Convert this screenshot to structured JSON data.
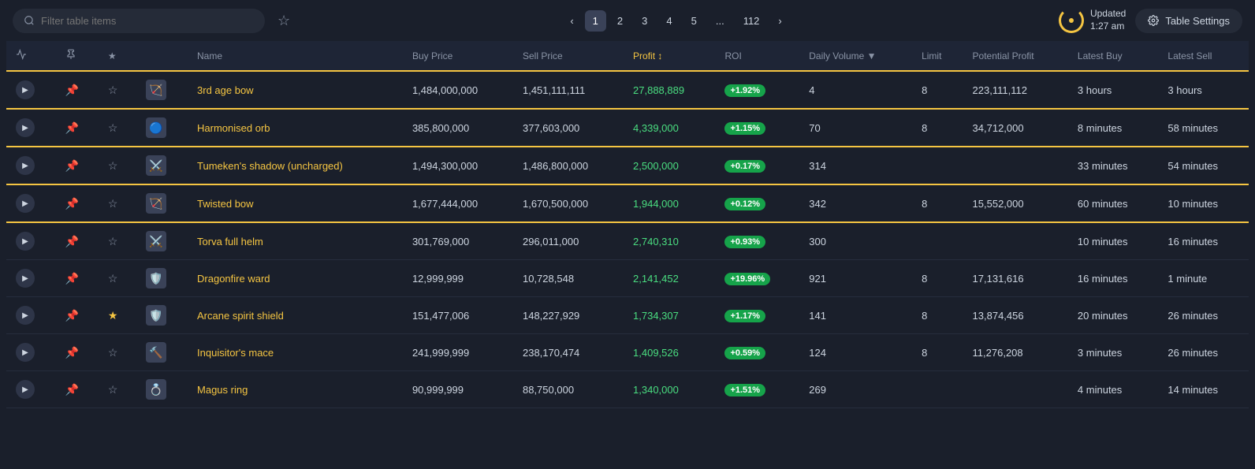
{
  "topbar": {
    "search_placeholder": "Filter table items",
    "pagination": {
      "prev": "‹",
      "next": "›",
      "pages": [
        "1",
        "2",
        "3",
        "4",
        "5",
        "...",
        "112"
      ],
      "active": "1"
    },
    "updated": {
      "label": "Updated",
      "time": "1:27 am"
    },
    "settings_label": "Table Settings"
  },
  "table": {
    "columns": [
      {
        "key": "expand",
        "label": ""
      },
      {
        "key": "pin",
        "label": ""
      },
      {
        "key": "star",
        "label": ""
      },
      {
        "key": "icon",
        "label": ""
      },
      {
        "key": "name",
        "label": "Name"
      },
      {
        "key": "buy_price",
        "label": "Buy Price"
      },
      {
        "key": "sell_price",
        "label": "Sell Price"
      },
      {
        "key": "profit",
        "label": "Profit"
      },
      {
        "key": "roi",
        "label": "ROI"
      },
      {
        "key": "daily_volume",
        "label": "Daily Volume"
      },
      {
        "key": "limit",
        "label": "Limit"
      },
      {
        "key": "potential_profit",
        "label": "Potential Profit"
      },
      {
        "key": "latest_buy",
        "label": "Latest Buy"
      },
      {
        "key": "latest_sell",
        "label": "Latest Sell"
      }
    ],
    "rows": [
      {
        "id": 1,
        "pinned": true,
        "starred": false,
        "icon": "🏹",
        "name": "3rd age bow",
        "buy_price": "1,484,000,000",
        "sell_price": "1,451,111,111",
        "profit": "27,888,889",
        "roi": "+1.92%",
        "daily_volume": "4",
        "limit": "8",
        "potential_profit": "223,111,112",
        "latest_buy": "3 hours",
        "latest_sell": "3 hours"
      },
      {
        "id": 2,
        "pinned": true,
        "starred": false,
        "icon": "🔵",
        "name": "Harmonised orb",
        "buy_price": "385,800,000",
        "sell_price": "377,603,000",
        "profit": "4,339,000",
        "roi": "+1.15%",
        "daily_volume": "70",
        "limit": "8",
        "potential_profit": "34,712,000",
        "latest_buy": "8 minutes",
        "latest_sell": "58 minutes"
      },
      {
        "id": 3,
        "pinned": true,
        "starred": false,
        "icon": "⚔️",
        "name": "Tumeken's shadow (uncharged)",
        "buy_price": "1,494,300,000",
        "sell_price": "1,486,800,000",
        "profit": "2,500,000",
        "roi": "+0.17%",
        "daily_volume": "314",
        "limit": "",
        "potential_profit": "",
        "latest_buy": "33 minutes",
        "latest_sell": "54 minutes"
      },
      {
        "id": 4,
        "pinned": true,
        "starred": false,
        "icon": "🏹",
        "name": "Twisted bow",
        "buy_price": "1,677,444,000",
        "sell_price": "1,670,500,000",
        "profit": "1,944,000",
        "roi": "+0.12%",
        "daily_volume": "342",
        "limit": "8",
        "potential_profit": "15,552,000",
        "latest_buy": "60 minutes",
        "latest_sell": "10 minutes"
      },
      {
        "id": 5,
        "pinned": false,
        "starred": false,
        "icon": "⚔️",
        "name": "Torva full helm",
        "buy_price": "301,769,000",
        "sell_price": "296,011,000",
        "profit": "2,740,310",
        "roi": "+0.93%",
        "daily_volume": "300",
        "limit": "",
        "potential_profit": "",
        "latest_buy": "10 minutes",
        "latest_sell": "16 minutes"
      },
      {
        "id": 6,
        "pinned": false,
        "starred": false,
        "icon": "🛡️",
        "name": "Dragonfire ward",
        "buy_price": "12,999,999",
        "sell_price": "10,728,548",
        "profit": "2,141,452",
        "roi": "+19.96%",
        "daily_volume": "921",
        "limit": "8",
        "potential_profit": "17,131,616",
        "latest_buy": "16 minutes",
        "latest_sell": "1 minute"
      },
      {
        "id": 7,
        "pinned": false,
        "starred": true,
        "icon": "🛡️",
        "name": "Arcane spirit shield",
        "buy_price": "151,477,006",
        "sell_price": "148,227,929",
        "profit": "1,734,307",
        "roi": "+1.17%",
        "daily_volume": "141",
        "limit": "8",
        "potential_profit": "13,874,456",
        "latest_buy": "20 minutes",
        "latest_sell": "26 minutes"
      },
      {
        "id": 8,
        "pinned": false,
        "starred": false,
        "icon": "🔨",
        "name": "Inquisitor's mace",
        "buy_price": "241,999,999",
        "sell_price": "238,170,474",
        "profit": "1,409,526",
        "roi": "+0.59%",
        "daily_volume": "124",
        "limit": "8",
        "potential_profit": "11,276,208",
        "latest_buy": "3 minutes",
        "latest_sell": "26 minutes"
      },
      {
        "id": 9,
        "pinned": false,
        "starred": false,
        "icon": "💍",
        "name": "Magus ring",
        "buy_price": "90,999,999",
        "sell_price": "88,750,000",
        "profit": "1,340,000",
        "roi": "+1.51%",
        "daily_volume": "269",
        "limit": "",
        "potential_profit": "",
        "latest_buy": "4 minutes",
        "latest_sell": "14 minutes"
      }
    ]
  }
}
